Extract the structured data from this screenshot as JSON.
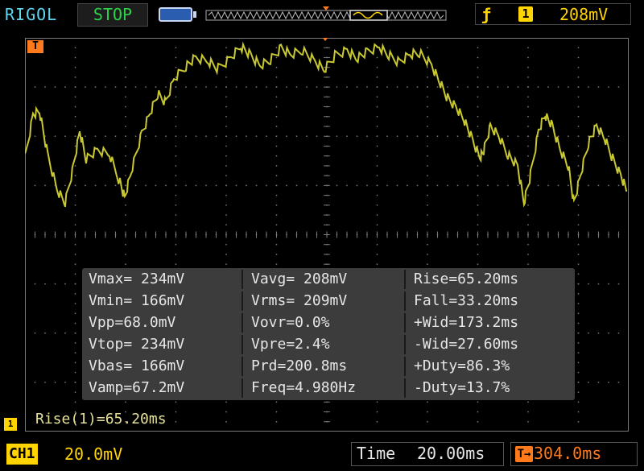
{
  "top": {
    "brand": "RIGOL",
    "run_state": "STOP",
    "trigger_source": "1",
    "trigger_level": "208mV",
    "trigger_edge_icon": "rising-edge-icon",
    "battery_icon": "battery-icon"
  },
  "markers": {
    "trigger_position": "T",
    "channel": "1"
  },
  "measurements": [
    [
      "Vmax= 234mV",
      "Vavg= 208mV",
      "Rise=65.20ms"
    ],
    [
      "Vmin= 166mV",
      "Vrms= 209mV",
      "Fall=33.20ms"
    ],
    [
      "Vpp=68.0mV",
      "Vovr=0.0%",
      "+Wid=173.2ms"
    ],
    [
      "Vtop= 234mV",
      "Vpre=2.4%",
      "-Wid=27.60ms"
    ],
    [
      "Vbas= 166mV",
      "Prd=200.8ms",
      "+Duty=86.3%"
    ],
    [
      "Vamp=67.2mV",
      "Freq=4.980Hz",
      "-Duty=13.7%"
    ]
  ],
  "readout": "Rise(1)=65.20ms",
  "bottom": {
    "channel_label": "CH1",
    "channel_scale": "20.0mV",
    "time_label": "Time",
    "time_value": "20.00ms",
    "offset_value": "304.0ms"
  },
  "colors": {
    "trace": "#c8c832",
    "grid": "#7a7a7a",
    "channel": "#ffd400",
    "trigger": "#ff7a1a",
    "brand": "#5fd6f0",
    "stop": "#2bd34a"
  }
}
